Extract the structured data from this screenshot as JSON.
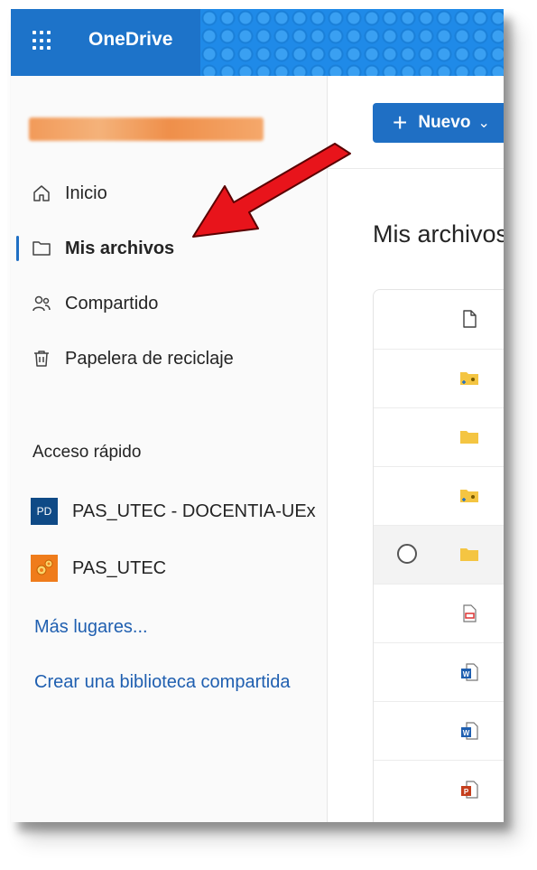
{
  "app": {
    "brand": "OneDrive"
  },
  "nav": {
    "items": [
      {
        "label": "Inicio",
        "icon": "home-icon"
      },
      {
        "label": "Mis archivos",
        "icon": "folder-icon",
        "active": true
      },
      {
        "label": "Compartido",
        "icon": "people-icon"
      },
      {
        "label": "Papelera de reciclaje",
        "icon": "trash-icon"
      }
    ],
    "quick_access_title": "Acceso rápido",
    "quick_access": [
      {
        "label": "PAS_UTEC - DOCENTIA-UEx",
        "badge": "PD"
      },
      {
        "label": "PAS_UTEC"
      }
    ],
    "more_places": "Más lugares...",
    "create_library": "Crear una biblioteca compartida"
  },
  "toolbar": {
    "new_label": "Nuevo",
    "new_plus": "+",
    "new_chevron": "⌄"
  },
  "main": {
    "title": "Mis archivos"
  },
  "files": [
    {
      "icon": "file-header-icon"
    },
    {
      "icon": "shared-folder-icon"
    },
    {
      "icon": "folder-icon"
    },
    {
      "icon": "shared-folder-icon"
    },
    {
      "icon": "folder-icon",
      "hover": true
    },
    {
      "icon": "pdf-file-icon"
    },
    {
      "icon": "word-file-icon"
    },
    {
      "icon": "word-file-icon"
    },
    {
      "icon": "powerpoint-file-icon"
    }
  ],
  "colors": {
    "topbar": "#1d73c9",
    "accent": "#1f6fc4",
    "arrow": "#e8141b",
    "username_blur": "#f29a59"
  }
}
